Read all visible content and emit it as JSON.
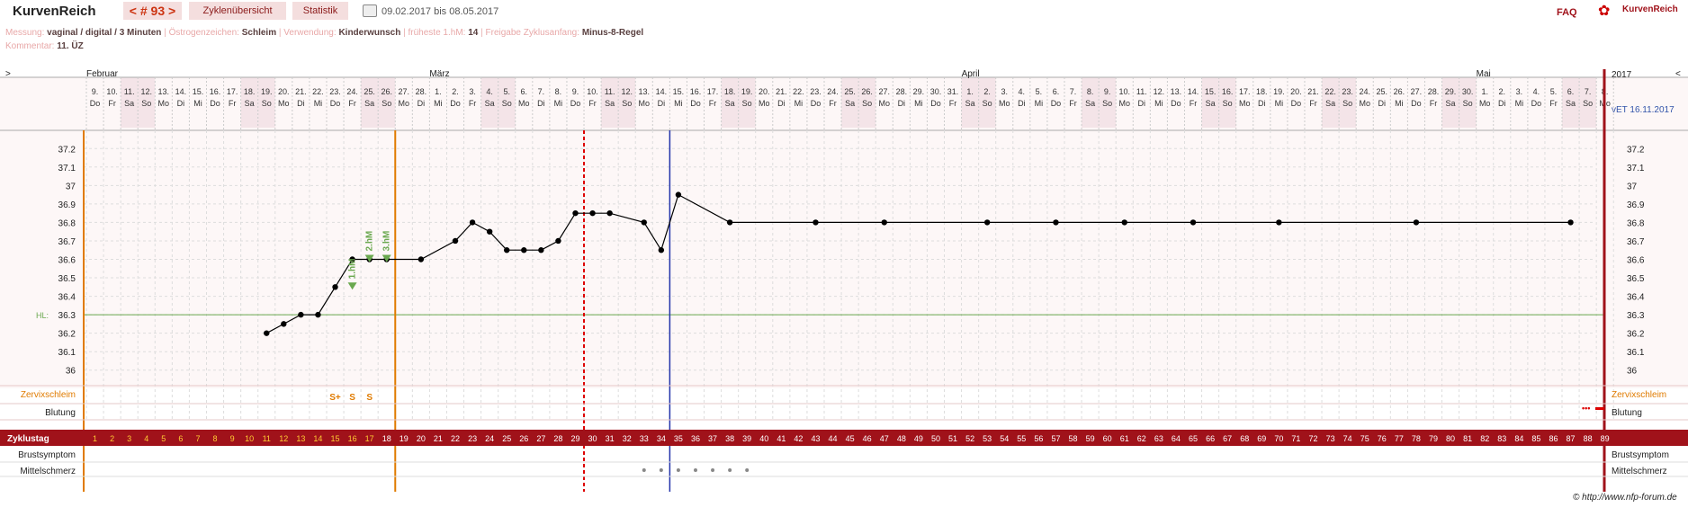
{
  "header": {
    "brand": "KurvenReich",
    "cycle_number": "< # 93 >",
    "tab_cycles": "Zyklenübersicht",
    "tab_stats": "Statistik",
    "date_range": "09.02.2017 bis 08.05.2017",
    "faq": "FAQ",
    "logo_text": "KurvenReich"
  },
  "meta": {
    "line1": [
      {
        "label": "Messung:",
        "value": "vaginal / digital / 3 Minuten"
      },
      {
        "label": "Östrogenzeichen:",
        "value": "Schleim"
      },
      {
        "label": "Verwendung:",
        "value": "Kinderwunsch"
      },
      {
        "label": "früheste 1.hM:",
        "value": "14"
      },
      {
        "label": "Freigabe Zyklusanfang:",
        "value": "Minus-8-Regel"
      }
    ],
    "comment_label": "Kommentar:",
    "comment_value": "11. ÜZ"
  },
  "colors": {
    "accent": "#a0121a",
    "curve": "#000000",
    "coverline": "#6aa84f",
    "ovulation_line": "#e07b00",
    "marker_red": "#dd0000",
    "marker_blue": "#2233aa",
    "weekend_bg": "#f4e4e8",
    "grid": "#cccccc"
  },
  "chart_data": {
    "type": "line",
    "months": [
      {
        "name": "Februar",
        "day_index": 0
      },
      {
        "name": "März",
        "day_index": 20
      },
      {
        "name": "April",
        "day_index": 51
      },
      {
        "name": "Mai",
        "day_index": 81
      }
    ],
    "year": "2017",
    "nav_left": ">",
    "nav_right": "<",
    "due_date": "vET 16.11.2017",
    "dates": [
      "9.",
      "10.",
      "11.",
      "12.",
      "13.",
      "14.",
      "15.",
      "16.",
      "17.",
      "18.",
      "19.",
      "20.",
      "21.",
      "22.",
      "23.",
      "24.",
      "25.",
      "26.",
      "27.",
      "28.",
      "1.",
      "2.",
      "3.",
      "4.",
      "5.",
      "6.",
      "7.",
      "8.",
      "9.",
      "10.",
      "11.",
      "12.",
      "13.",
      "14.",
      "15.",
      "16.",
      "17.",
      "18.",
      "19.",
      "20.",
      "21.",
      "22.",
      "23.",
      "24.",
      "25.",
      "26.",
      "27.",
      "28.",
      "29.",
      "30.",
      "31.",
      "1.",
      "2.",
      "3.",
      "4.",
      "5.",
      "6.",
      "7.",
      "8.",
      "9.",
      "10.",
      "11.",
      "12.",
      "13.",
      "14.",
      "15.",
      "16.",
      "17.",
      "18.",
      "19.",
      "20.",
      "21.",
      "22.",
      "23.",
      "24.",
      "25.",
      "26.",
      "27.",
      "28.",
      "29.",
      "30.",
      "1.",
      "2.",
      "3.",
      "4.",
      "5.",
      "6.",
      "7.",
      "8."
    ],
    "weekdays": [
      "Do",
      "Fr",
      "Sa",
      "So",
      "Mo",
      "Di",
      "Mi",
      "Do",
      "Fr",
      "Sa",
      "So",
      "Mo",
      "Di",
      "Mi",
      "Do",
      "Fr",
      "Sa",
      "So",
      "Mo",
      "Di",
      "Mi",
      "Do",
      "Fr",
      "Sa",
      "So",
      "Mo",
      "Di",
      "Mi",
      "Do",
      "Fr",
      "Sa",
      "So",
      "Mo",
      "Di",
      "Mi",
      "Do",
      "Fr",
      "Sa",
      "So",
      "Mo",
      "Di",
      "Mi",
      "Do",
      "Fr",
      "Sa",
      "So",
      "Mo",
      "Di",
      "Mi",
      "Do",
      "Fr",
      "Sa",
      "So",
      "Mo",
      "Di",
      "Mi",
      "Do",
      "Fr",
      "Sa",
      "So",
      "Mo",
      "Di",
      "Mi",
      "Do",
      "Fr",
      "Sa",
      "So",
      "Mo",
      "Di",
      "Mi",
      "Do",
      "Fr",
      "Sa",
      "So",
      "Mo",
      "Di",
      "Mi",
      "Do",
      "Fr",
      "Sa",
      "So",
      "Mo",
      "Di",
      "Mi",
      "Do",
      "Fr",
      "Sa",
      "So",
      "Mo"
    ],
    "y_ticks": [
      "37.2",
      "37.1",
      "37",
      "36.9",
      "36.8",
      "36.7",
      "36.6",
      "36.5",
      "36.4",
      "36.3",
      "36.2",
      "36.1",
      "36"
    ],
    "ylim": [
      35.95,
      37.25
    ],
    "coverline": {
      "value": 36.3,
      "label": "HL:"
    },
    "series": [
      {
        "x": [
          10,
          11,
          12,
          13,
          14,
          15,
          16,
          17,
          19,
          21,
          22,
          23,
          24,
          25,
          26,
          27,
          28,
          29,
          30,
          32,
          33,
          34,
          37,
          42,
          46,
          52,
          56,
          60,
          64,
          69,
          77,
          86
        ],
        "y": [
          36.2,
          36.25,
          36.3,
          36.3,
          36.45,
          36.6,
          36.6,
          36.6,
          36.6,
          36.7,
          36.8,
          36.75,
          36.65,
          36.65,
          36.65,
          36.7,
          36.85,
          36.85,
          36.85,
          36.8,
          36.65,
          36.95,
          36.8,
          36.8,
          36.8,
          36.8,
          36.8,
          36.8,
          36.8,
          36.8,
          36.8,
          36.8
        ]
      }
    ],
    "peak_markers": [
      {
        "day": 15,
        "value": 36.45,
        "label": "1.hM"
      },
      {
        "day": 16,
        "value": 36.6,
        "label": "2.hM"
      },
      {
        "day": 17,
        "value": 36.6,
        "label": "3.hM"
      }
    ],
    "vertical_markers": [
      {
        "day": 17,
        "style": "ovulation"
      },
      {
        "day": 28,
        "style": "red-dashed"
      },
      {
        "day": 33,
        "style": "blue"
      }
    ],
    "rows": {
      "zervix_label": "Zervixschleim",
      "zervix_entries": [
        {
          "day": 14,
          "text": "S+"
        },
        {
          "day": 15,
          "text": "S"
        },
        {
          "day": 16,
          "text": "S"
        }
      ],
      "blutung_label": "Blutung",
      "zyklustag_label": "Zyklustag",
      "cycle_days_count": 89,
      "brust_label": "Brustsymptom",
      "mittel_label": "Mittelschmerz",
      "mittel_days": [
        32,
        33,
        34,
        35,
        36,
        37,
        38
      ]
    }
  },
  "footer": {
    "credit": "© http://www.nfp-forum.de"
  }
}
